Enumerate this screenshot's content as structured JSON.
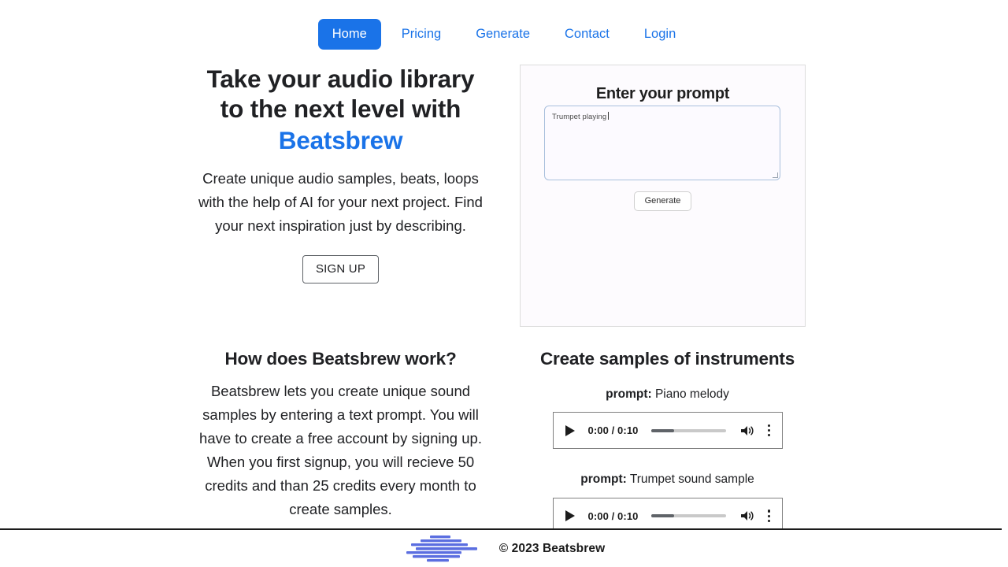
{
  "colors": {
    "accent_blue": "#1a73e8",
    "text_dark": "#202124",
    "logo_blue": "#5b6ee0",
    "player_border": "#808080",
    "panel_border": "#dcdcdc",
    "textarea_border": "#a9c0dd"
  },
  "nav": {
    "items": [
      {
        "label": "Home",
        "active": true
      },
      {
        "label": "Pricing",
        "active": false
      },
      {
        "label": "Generate",
        "active": false
      },
      {
        "label": "Contact",
        "active": false
      },
      {
        "label": "Login",
        "active": false
      }
    ]
  },
  "hero": {
    "title_line1": "Take your audio library to",
    "title_line2": "the next level with",
    "brand": "Beatsbrew",
    "subtitle": "Create unique audio samples, beats, loops with the help of AI for your next project. Find your next inspiration just by describing.",
    "signup_label": "SIGN UP"
  },
  "hero_mock": {
    "title": "Enter your prompt",
    "textarea_value": "Trumpet playing",
    "textarea_placeholder": "",
    "generate_label": "Generate"
  },
  "how_section": {
    "heading": "How does Beatsbrew work?",
    "body": "Beatsbrew lets you create unique sound samples by entering a text prompt. You will have to create a free account by signing up. When you first signup, you will recieve 50 credits and than 25 credits every month to create samples."
  },
  "samples_section": {
    "heading": "Create samples of instruments",
    "prompt_label": "prompt:",
    "samples": [
      {
        "prompt_value": "Piano melody",
        "player": {
          "time": "0:00 / 0:10",
          "current_time": "0:00",
          "duration": "0:10",
          "progress_percent": 30,
          "play_icon": "play-icon",
          "volume_icon": "volume-high-icon",
          "menu_icon": "more-vertical-icon"
        }
      },
      {
        "prompt_value": "Trumpet sound sample",
        "player": {
          "time": "0:00 / 0:10",
          "current_time": "0:00",
          "duration": "0:10",
          "progress_percent": 30,
          "play_icon": "play-icon",
          "volume_icon": "volume-high-icon",
          "menu_icon": "more-vertical-icon"
        }
      }
    ]
  },
  "footer": {
    "logo_icon": "waveform-logo-icon",
    "copyright": "© 2023 Beatsbrew"
  }
}
